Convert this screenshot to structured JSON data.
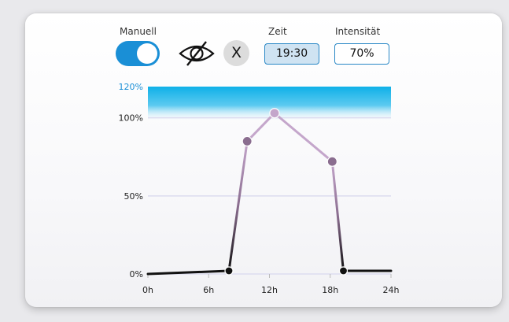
{
  "controls": {
    "manual_label": "Manuell",
    "manual_toggle_on": true,
    "visibility_icon": "eye-slash-icon",
    "close_label": "X",
    "time_label": "Zeit",
    "time_value": "19:30",
    "intensity_label": "Intensität",
    "intensity_value": "70%"
  },
  "colors": {
    "accent": "#1a8fd6",
    "limit_zone_top": "#0fb0e8",
    "limit_label": "#1a8fd6",
    "grid": "#dcdcef",
    "curve_high": "#c4a6cb",
    "curve_mid": "#8a6d8f",
    "curve_low": "#111111"
  },
  "chart_data": {
    "type": "line",
    "xlabel": "",
    "ylabel": "",
    "x_unit": "h",
    "xlim": [
      0,
      24
    ],
    "ylim": [
      0,
      120
    ],
    "x_ticks": [
      0,
      6,
      12,
      18,
      24
    ],
    "x_tick_labels": [
      "0h",
      "6h",
      "12h",
      "18h",
      "24h"
    ],
    "y_tick_labels": [
      {
        "value": 0,
        "label": "0%"
      },
      {
        "value": 50,
        "label": "50%"
      },
      {
        "value": 100,
        "label": "100%"
      },
      {
        "value": 120,
        "label": "120%"
      }
    ],
    "grid": true,
    "highlight_zone": [
      100,
      120
    ],
    "series": [
      {
        "points": [
          {
            "x": 0,
            "y": 0
          },
          {
            "x": 8,
            "y": 2
          },
          {
            "x": 9.8,
            "y": 85
          },
          {
            "x": 12.5,
            "y": 103
          },
          {
            "x": 18.2,
            "y": 72
          },
          {
            "x": 19.3,
            "y": 2
          },
          {
            "x": 24,
            "y": 2
          }
        ],
        "markers": [
          1,
          2,
          3,
          4,
          5
        ]
      }
    ]
  }
}
